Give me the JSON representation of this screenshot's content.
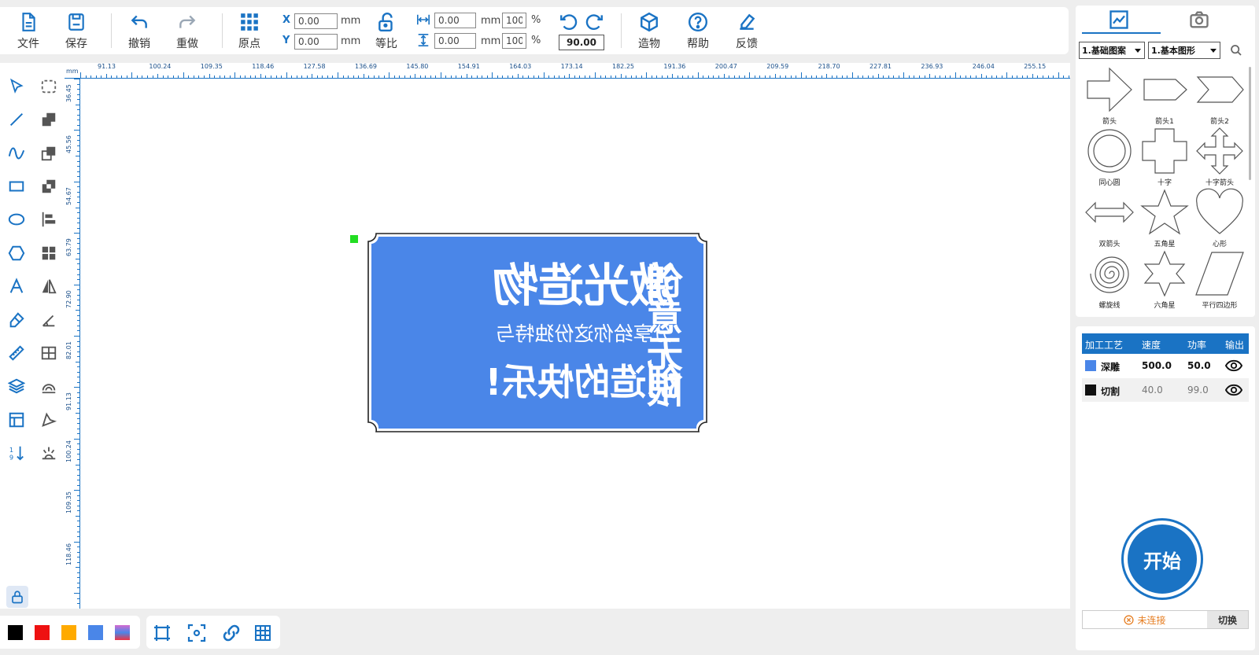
{
  "toolbar": {
    "file": "文件",
    "save": "保存",
    "undo": "撤销",
    "redo": "重做",
    "origin": "原点",
    "ratio": "等比",
    "create": "造物",
    "help": "帮助",
    "feedback": "反馈",
    "x_label": "X",
    "y_label": "Y",
    "x_value": "0.00",
    "y_value": "0.00",
    "unit_mm": "mm",
    "w_value": "0.00",
    "h_value": "0.00",
    "w_pct": "100",
    "h_pct": "100",
    "pct": "%",
    "rotation": "90.00"
  },
  "ruler": {
    "unit": "mm",
    "top": [
      "91.13",
      "100.24",
      "109.35",
      "118.46",
      "127.58",
      "136.69",
      "145.80",
      "154.91",
      "164.03",
      "173.14",
      "182.25",
      "191.36",
      "200.47",
      "209.59",
      "218.70",
      "227.81",
      "236.93",
      "246.04",
      "255.15"
    ],
    "left": [
      "36.45",
      "45.56",
      "54.67",
      "63.79",
      "72.90",
      "82.01",
      "91.13",
      "100.24",
      "109.35",
      "118.46"
    ]
  },
  "design": {
    "fill_color": "#4a86e8",
    "line1": "激光造物",
    "line2": "分享给你这份独特与",
    "line3": "创造的快乐!",
    "side": "创意无限"
  },
  "colors": [
    "#000000",
    "#ee1111",
    "#ffaa00",
    "#4a86e8",
    "#d46bd0"
  ],
  "library": {
    "category": "1.基础图案",
    "subcategory": "1.基本图形",
    "shapes": [
      {
        "name": "箭头",
        "icon": "arrow-icon"
      },
      {
        "name": "箭头1",
        "icon": "arrow-tag-icon"
      },
      {
        "name": "箭头2",
        "icon": "chevron-arrow-icon"
      },
      {
        "name": "同心圆",
        "icon": "concentric-circle-icon"
      },
      {
        "name": "十字",
        "icon": "cross-icon"
      },
      {
        "name": "十字箭头",
        "icon": "cross-arrow-icon"
      },
      {
        "name": "双箭头",
        "icon": "double-arrow-icon"
      },
      {
        "name": "五角星",
        "icon": "five-star-icon"
      },
      {
        "name": "心形",
        "icon": "heart-icon"
      },
      {
        "name": "螺旋线",
        "icon": "spiral-icon"
      },
      {
        "name": "六角星",
        "icon": "six-star-icon"
      },
      {
        "name": "平行四边形",
        "icon": "parallelogram-icon"
      }
    ]
  },
  "process_table": {
    "headers": [
      "加工工艺",
      "速度",
      "功率",
      "输出"
    ],
    "rows": [
      {
        "color": "#4a86e8",
        "name": "深雕",
        "speed": "500.0",
        "power": "50.0"
      },
      {
        "color": "#111111",
        "name": "切割",
        "speed": "40.0",
        "power": "99.0"
      }
    ]
  },
  "start_label": "开始",
  "connection": {
    "status": "未连接",
    "switch": "切换"
  }
}
